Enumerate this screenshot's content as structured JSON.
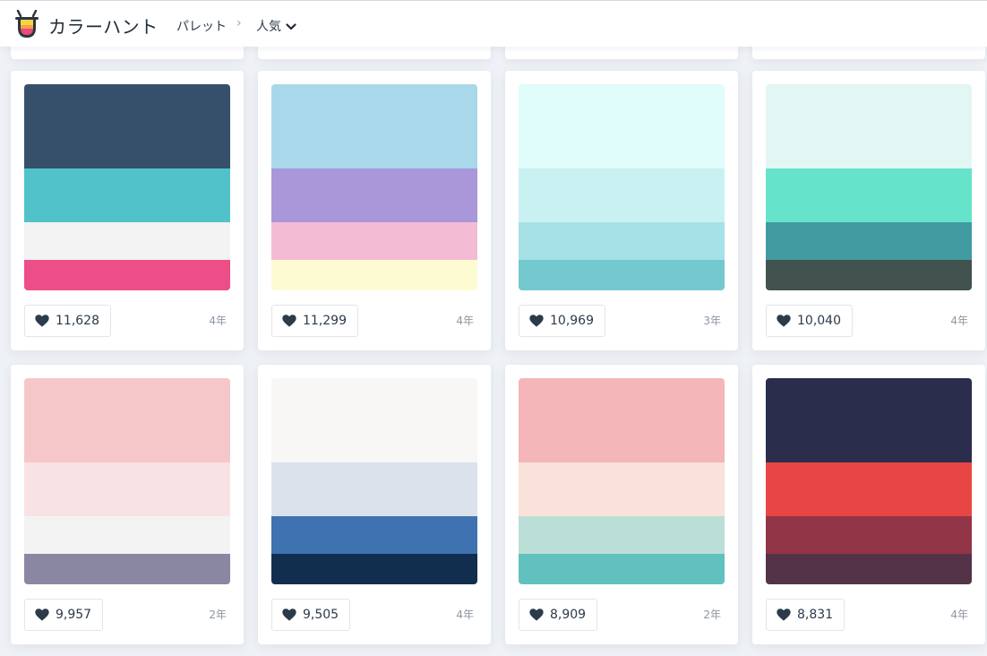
{
  "header": {
    "app_title": "カラーハント",
    "breadcrumb_palette": "パレット",
    "breadcrumb_separator": "›",
    "sort_label": "人気"
  },
  "palettes": [
    {
      "colors": [
        "#36506b",
        "#52c2ca",
        "#f3f3f3",
        "#ee4e87"
      ],
      "likes": "11,628",
      "age": "4年"
    },
    {
      "colors": [
        "#a9d8ea",
        "#aa97d9",
        "#f4bbd4",
        "#fdfbd2"
      ],
      "likes": "11,299",
      "age": "4年"
    },
    {
      "colors": [
        "#e0fcfb",
        "#c9f1f2",
        "#a5e1e6",
        "#73c9cd"
      ],
      "likes": "10,969",
      "age": "3年"
    },
    {
      "colors": [
        "#e2f6f3",
        "#66e3cb",
        "#419ba1",
        "#42524f"
      ],
      "likes": "10,040",
      "age": "4年"
    },
    {
      "colors": [
        "#f6c7c9",
        "#f9e2e3",
        "#f3f3f3",
        "#8a87a2"
      ],
      "likes": "9,957",
      "age": "2年"
    },
    {
      "colors": [
        "#f8f7f5",
        "#dbe2ec",
        "#3f72b0",
        "#112e4f"
      ],
      "likes": "9,505",
      "age": "4年"
    },
    {
      "colors": [
        "#f5b6b9",
        "#f9e2d9",
        "#bbdfd6",
        "#61c1be"
      ],
      "likes": "8,909",
      "age": "2年"
    },
    {
      "colors": [
        "#2b2d4d",
        "#e84645",
        "#923547",
        "#543348"
      ],
      "likes": "8,831",
      "age": "4年"
    }
  ]
}
